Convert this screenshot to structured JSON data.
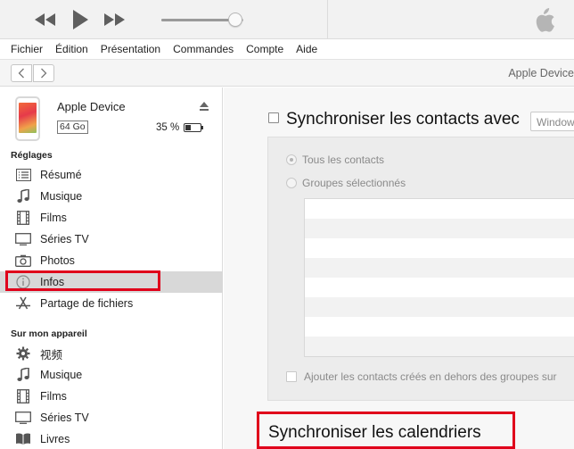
{
  "toolbar": {
    "rewind_icon": "rewind-icon",
    "play_icon": "play-icon",
    "fast_forward_icon": "fast-forward-icon",
    "volume_level": 0.9,
    "logo_icon": "apple-logo-icon"
  },
  "menu": {
    "items": [
      "Fichier",
      "Édition",
      "Présentation",
      "Commandes",
      "Compte",
      "Aide"
    ]
  },
  "nav": {
    "back_icon": "chevron-left-icon",
    "forward_icon": "chevron-right-icon",
    "title": "Apple Device"
  },
  "device": {
    "name": "Apple Device",
    "capacity": "64 Go",
    "battery_text": "35 %",
    "battery_level": 0.35,
    "eject_icon": "eject-icon"
  },
  "sidebar": {
    "settings_title": "Réglages",
    "settings_items": [
      {
        "label": "Résumé",
        "icon": "list-icon"
      },
      {
        "label": "Musique",
        "icon": "music-note-icon"
      },
      {
        "label": "Films",
        "icon": "film-icon"
      },
      {
        "label": "Séries TV",
        "icon": "tv-icon"
      },
      {
        "label": "Photos",
        "icon": "camera-icon"
      },
      {
        "label": "Infos",
        "icon": "info-icon",
        "selected": true
      },
      {
        "label": "Partage de fichiers",
        "icon": "app-store-icon"
      }
    ],
    "device_title": "Sur mon appareil",
    "device_items": [
      {
        "label": "视频",
        "icon": "gear-icon"
      },
      {
        "label": "Musique",
        "icon": "music-note-icon"
      },
      {
        "label": "Films",
        "icon": "film-icon"
      },
      {
        "label": "Séries TV",
        "icon": "tv-icon"
      },
      {
        "label": "Livres",
        "icon": "book-icon"
      }
    ]
  },
  "main": {
    "contacts": {
      "heading": "Synchroniser les contacts avec",
      "dropdown_value": "Windows",
      "option_all": "Tous les contacts",
      "option_groups": "Groupes sélectionnés",
      "add_contacts_label": "Ajouter les contacts créés en dehors des groupes sur"
    },
    "calendars": {
      "heading": "Synchroniser les calendriers"
    }
  },
  "colors": {
    "highlight": "#e0001b",
    "selected_row": "#d8d8d8"
  }
}
